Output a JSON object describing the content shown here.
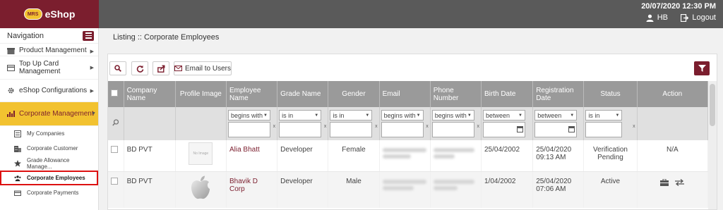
{
  "brand": {
    "badge": "MRS",
    "name": "eShop"
  },
  "topbar": {
    "datetime": "20/07/2020 12:30 PM",
    "user": "HB",
    "logout": "Logout"
  },
  "nav": {
    "title": "Navigation",
    "items": [
      {
        "label": "Product Management"
      },
      {
        "label": "Top Up Card Management"
      },
      {
        "label": "eShop Configurations"
      },
      {
        "label": "Corporate Management"
      }
    ],
    "sub_items": [
      {
        "label": "My Companies"
      },
      {
        "label": "Corporate Customer"
      },
      {
        "label": "Grade Allowance Manage..."
      },
      {
        "label": "Corporate Employees"
      },
      {
        "label": "Corporate Payments"
      }
    ]
  },
  "page": {
    "title": "Listing :: Corporate Employees"
  },
  "toolbar": {
    "email_label": "Email to Users"
  },
  "table": {
    "headers": [
      "",
      "Company Name",
      "Profile Image",
      "Employee Name",
      "Grade Name",
      "Gender",
      "Email",
      "Phone Number",
      "Birth Date",
      "Registration Date",
      "Status",
      "Action"
    ],
    "filters": {
      "employee": "begins with",
      "grade": "is in",
      "gender": "is in",
      "email": "begins with",
      "phone": "begins with",
      "birth": "between",
      "registration": "between",
      "status": "is in"
    },
    "rows": [
      {
        "company": "BD PVT",
        "image": "No Image",
        "employee": "Alia Bhatt",
        "grade": "Developer",
        "gender": "Female",
        "birth": "25/04/2002",
        "registration": "25/04/2020 09:13 AM",
        "status": "Verification Pending",
        "action": "N/A"
      },
      {
        "company": "BD PVT",
        "employee": "Bhavik D Corp",
        "grade": "Developer",
        "gender": "Male",
        "birth": "1/04/2002",
        "registration": "25/04/2020 07:06 AM",
        "status": "Active"
      }
    ]
  },
  "colors": {
    "brand": "#7b1e2e",
    "accent": "#f2c230",
    "header": "#9a9a9a",
    "topbar": "#5a5a5a"
  }
}
